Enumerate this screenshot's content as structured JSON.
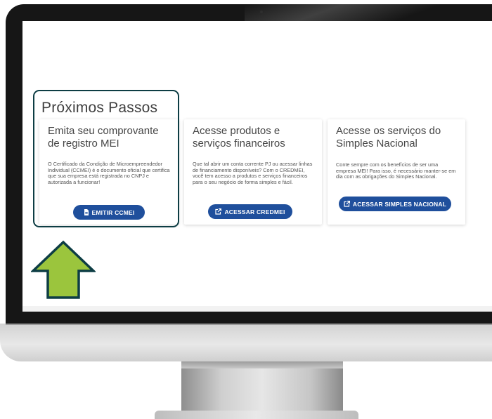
{
  "section_title": "Próximos Passos",
  "cards": [
    {
      "title": "Emita seu comprovante de registro MEI",
      "text": "O Certificado da Condição de Microempreendedor Individual (CCMEI) é o documento oficial que certifica que sua empresa está registrada no CNPJ e autorizada a funcionar!",
      "button_label": "EMITIR CCMEI",
      "button_icon": "document-icon"
    },
    {
      "title": "Acesse produtos e serviços financeiros",
      "text": "Que tal abrir um conta corrente PJ ou acessar linhas de financiamento disponíveis? Com o CREDMEI, você tem acesso a produtos e serviços financeiros para o seu negócio de forma simples e fácil.",
      "button_label": "ACESSAR CREDMEI",
      "button_icon": "external-link-icon"
    },
    {
      "title": "Acesse os serviços do Simples Nacional",
      "text": "Conte sempre com os benefícios de ser uma empresa MEI! Para isso, é necessário manter-se em dia com as obrigações do Simples Nacional.",
      "button_label": "ACESSAR SIMPLES NACIONAL",
      "button_icon": "external-link-icon"
    }
  ],
  "colors": {
    "button": "#1f4f9c",
    "highlight_border": "#0d3d44",
    "arrow_fill": "#9bc53d",
    "arrow_stroke": "#0d3d44",
    "bezel": "#161616"
  },
  "arrow_icon": "up-arrow-icon"
}
